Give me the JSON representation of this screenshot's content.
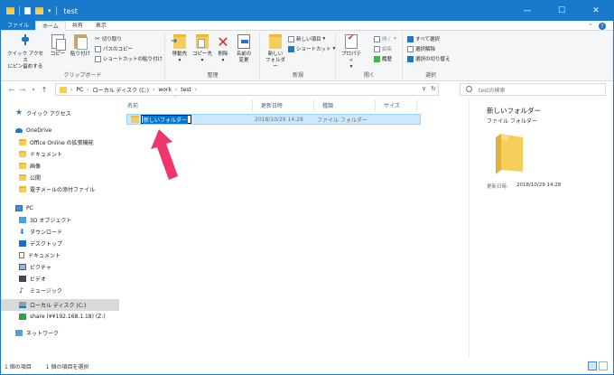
{
  "window": {
    "title": "test",
    "minimize": "—",
    "maximize": "☐",
    "close": "✕"
  },
  "tabs": [
    "ファイル",
    "ホーム",
    "共有",
    "表示"
  ],
  "ribbon": {
    "clipboard": {
      "label": "クリップボード",
      "pin": "クイック アクセス\nにピン留めする",
      "copy": "コピー",
      "paste": "貼り付け",
      "cut": "切り取り",
      "copy_path": "パスのコピー",
      "paste_shortcut": "ショートカットの貼り付け"
    },
    "organize": {
      "label": "整理",
      "move_to": "移動先",
      "copy_to": "コピー先",
      "delete": "削除",
      "rename": "名前の\n変更"
    },
    "new": {
      "label": "新規",
      "new_folder": "新しい\nフォルダー",
      "new_item": "新しい項目",
      "shortcut": "ショートカット"
    },
    "open": {
      "label": "開く",
      "properties": "プロパティ",
      "open": "開く",
      "edit": "編集",
      "history": "履歴"
    },
    "select": {
      "label": "選択",
      "select_all": "すべて選択",
      "select_none": "選択解除",
      "invert": "選択の切り替え"
    }
  },
  "address": {
    "crumbs": [
      "PC",
      "ローカル ディスク (C:)",
      "work",
      "test"
    ],
    "search_placeholder": "testの検索"
  },
  "nav": [
    {
      "label": "クイック アクセス",
      "icon": "star-icon",
      "indent": 0
    },
    {
      "label": "OneDrive",
      "icon": "cloud-icon",
      "indent": 0
    },
    {
      "label": "Office Online の拡張機能",
      "icon": "folder-icon",
      "indent": 1
    },
    {
      "label": "ドキュメント",
      "icon": "folder-icon",
      "indent": 1
    },
    {
      "label": "画像",
      "icon": "folder-icon",
      "indent": 1
    },
    {
      "label": "公開",
      "icon": "folder-icon",
      "indent": 1
    },
    {
      "label": "電子メールの添付ファイル",
      "icon": "folder-icon",
      "indent": 1
    },
    {
      "label": "PC",
      "icon": "pc-icon",
      "indent": 0
    },
    {
      "label": "3D オブジェクト",
      "icon": "3d-objects-icon",
      "indent": 1
    },
    {
      "label": "ダウンロード",
      "icon": "download-icon",
      "indent": 1
    },
    {
      "label": "デスクトップ",
      "icon": "desktop-icon",
      "indent": 1
    },
    {
      "label": "ドキュメント",
      "icon": "documents-icon",
      "indent": 1
    },
    {
      "label": "ピクチャ",
      "icon": "pictures-icon",
      "indent": 1
    },
    {
      "label": "ビデオ",
      "icon": "videos-icon",
      "indent": 1
    },
    {
      "label": "ミュージック",
      "icon": "music-icon",
      "indent": 1
    },
    {
      "label": "ローカル ディスク (C:)",
      "icon": "disk-icon",
      "indent": 1,
      "selected": true
    },
    {
      "label": "share (¥¥192.168.1.18) (Z:)",
      "icon": "network-drive-icon",
      "indent": 1
    },
    {
      "label": "ネットワーク",
      "icon": "network-icon",
      "indent": 0
    }
  ],
  "list": {
    "columns": [
      "名前",
      "更新日時",
      "種類",
      "サイズ"
    ],
    "rows": [
      {
        "name": "新しいフォルダー",
        "modified": "2018/10/29 14:28",
        "type": "ファイル フォルダー",
        "size": ""
      }
    ]
  },
  "preview": {
    "title": "新しいフォルダー",
    "subtitle": "ファイル フォルダー",
    "date_label": "更新日時:",
    "date": "2018/10/29 14:28"
  },
  "status": {
    "item_count": "1 個の項目",
    "selected": "1 個の項目を選択"
  },
  "colors": {
    "accent": "#1979ca",
    "selection": "#cce8ff",
    "folder": "#f5cd5b",
    "arrow": "#f0356b"
  }
}
